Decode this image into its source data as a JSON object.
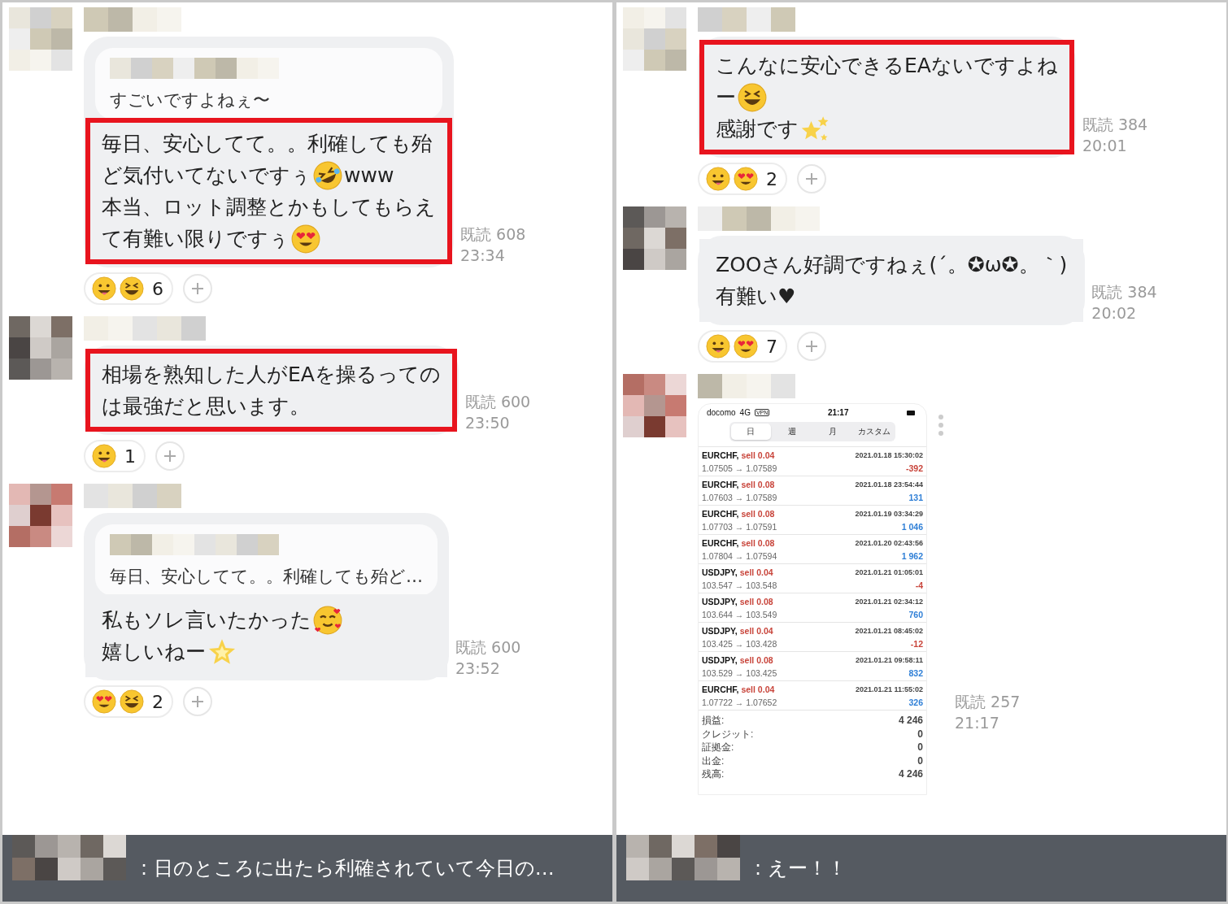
{
  "panels": [
    {
      "messages": [
        {
          "kind": "text",
          "read": "既読 608",
          "time": "23:34",
          "highlighted": true,
          "quote": {
            "text": "すごいですよねぇ〜"
          },
          "lines": [
            [
              {
                "kind": "text",
                "text": "毎日、安心してて。。利確しても殆"
              }
            ],
            [
              {
                "kind": "text",
                "text": "ど気付いてないですぅ"
              },
              {
                "kind": "rofl"
              },
              {
                "kind": "text",
                "text": "www"
              }
            ],
            [
              {
                "kind": "text",
                "text": "本当、ロット調整とかもしてもらえ"
              }
            ],
            [
              {
                "kind": "text",
                "text": "て有難い限りですぅ"
              },
              {
                "kind": "heart-eyes"
              }
            ]
          ],
          "reaction": {
            "faces": [
              {
                "kind": "grin"
              },
              {
                "kind": "laugh"
              }
            ],
            "count": "6"
          }
        },
        {
          "kind": "text",
          "read": "既読 600",
          "time": "23:50",
          "highlighted": true,
          "lines": [
            [
              {
                "kind": "text",
                "text": "相場を熟知した人がEAを操るっての"
              }
            ],
            [
              {
                "kind": "text",
                "text": "は最強だと思います。"
              }
            ]
          ],
          "reaction": {
            "faces": [
              {
                "kind": "grin"
              }
            ],
            "count": "1"
          }
        },
        {
          "kind": "text",
          "read": "既読 600",
          "time": "23:52",
          "highlighted": false,
          "quote": {
            "text": "毎日、安心してて。。利確しても殆ど…"
          },
          "lines": [
            [
              {
                "kind": "text",
                "text": "私もソレ言いたかった"
              },
              {
                "kind": "smiling-hearts"
              }
            ],
            [
              {
                "kind": "text",
                "text": "嬉しいねー"
              },
              {
                "kind": "star"
              }
            ]
          ],
          "reaction": {
            "faces": [
              {
                "kind": "heart-eyes"
              },
              {
                "kind": "laugh"
              }
            ],
            "count": "2"
          }
        }
      ],
      "banner": {
        "text": ": 日のところに出たら利確されていて今日の…"
      }
    },
    {
      "messages": [
        {
          "kind": "text",
          "read": "既読 384",
          "time": "20:01",
          "highlighted": true,
          "lines": [
            [
              {
                "kind": "text",
                "text": "こんなに安心できるEAないですよね"
              }
            ],
            [
              {
                "kind": "text",
                "text": "ー"
              },
              {
                "kind": "laugh"
              }
            ],
            [
              {
                "kind": "text",
                "text": "感謝です"
              },
              {
                "kind": "sparkles"
              }
            ]
          ],
          "reaction": {
            "faces": [
              {
                "kind": "grin"
              },
              {
                "kind": "heart-eyes"
              }
            ],
            "count": "2"
          }
        },
        {
          "kind": "text",
          "read": "既読 384",
          "time": "20:02",
          "highlighted": false,
          "lines": [
            [
              {
                "kind": "text",
                "text": "ZOOさん好調ですねぇ(´。✪ω✪。｀)"
              }
            ],
            [
              {
                "kind": "text",
                "text": "有難い♥"
              }
            ]
          ],
          "reaction": {
            "faces": [
              {
                "kind": "grin"
              },
              {
                "kind": "heart-eyes"
              }
            ],
            "count": "7"
          }
        },
        {
          "kind": "image",
          "read": "既読 257",
          "time": "21:17",
          "screenshot": {
            "carrier": "docomo",
            "network": "4G",
            "vpn": "VPN",
            "clock": "21:17",
            "tabs": [
              {
                "label": "日",
                "selected": true
              },
              {
                "label": "週",
                "selected": false
              },
              {
                "label": "月",
                "selected": false
              },
              {
                "label": "カスタム",
                "selected": false
              }
            ],
            "trades": [
              {
                "symbol": "EURCHF,",
                "side": "sell 0.04",
                "date": "2021.01.18 15:30:02",
                "prices": "1.07505 → 1.07589",
                "profit": "-392",
                "negative": true
              },
              {
                "symbol": "EURCHF,",
                "side": "sell 0.08",
                "date": "2021.01.18 23:54:44",
                "prices": "1.07603 → 1.07589",
                "profit": "131",
                "negative": false
              },
              {
                "symbol": "EURCHF,",
                "side": "sell 0.08",
                "date": "2021.01.19 03:34:29",
                "prices": "1.07703 → 1.07591",
                "profit": "1 046",
                "negative": false
              },
              {
                "symbol": "EURCHF,",
                "side": "sell 0.08",
                "date": "2021.01.20 02:43:56",
                "prices": "1.07804 → 1.07594",
                "profit": "1 962",
                "negative": false
              },
              {
                "symbol": "USDJPY,",
                "side": "sell 0.04",
                "date": "2021.01.21 01:05:01",
                "prices": "103.547 → 103.548",
                "profit": "-4",
                "negative": true
              },
              {
                "symbol": "USDJPY,",
                "side": "sell 0.08",
                "date": "2021.01.21 02:34:12",
                "prices": "103.644 → 103.549",
                "profit": "760",
                "negative": false
              },
              {
                "symbol": "USDJPY,",
                "side": "sell 0.04",
                "date": "2021.01.21 08:45:02",
                "prices": "103.425 → 103.428",
                "profit": "-12",
                "negative": true
              },
              {
                "symbol": "USDJPY,",
                "side": "sell 0.08",
                "date": "2021.01.21 09:58:11",
                "prices": "103.529 → 103.425",
                "profit": "832",
                "negative": false
              },
              {
                "symbol": "EURCHF,",
                "side": "sell 0.04",
                "date": "2021.01.21 11:55:02",
                "prices": "1.07722 → 1.07652",
                "profit": "326",
                "negative": false
              }
            ],
            "summary": [
              {
                "label": "損益:",
                "value": "4 246"
              },
              {
                "label": "クレジット:",
                "value": "0"
              },
              {
                "label": "証拠金:",
                "value": "0"
              },
              {
                "label": "出金:",
                "value": "0"
              },
              {
                "label": "残高:",
                "value": "4 246"
              }
            ]
          }
        }
      ],
      "banner": {
        "text": ": えー！！"
      }
    }
  ]
}
